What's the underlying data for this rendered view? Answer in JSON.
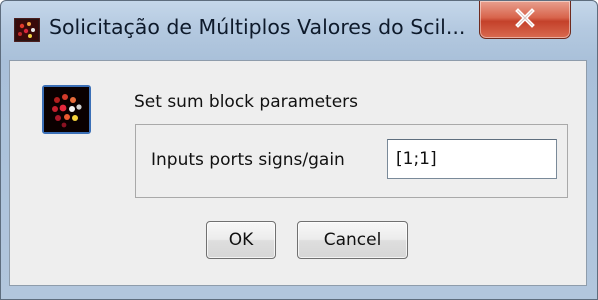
{
  "window": {
    "title": "Solicitação de Múltiplos Valores do Scil...",
    "app_icon": "scilab-icon",
    "close_icon": "close-icon",
    "close_button_color": "#c9432c",
    "frame_color": "#b4c9e0"
  },
  "dialog": {
    "icon": "scilab-dots-icon",
    "message": "Set sum block parameters",
    "parameters": [
      {
        "label": "Inputs ports signs/gain",
        "value": "[1;1]"
      }
    ],
    "buttons": {
      "ok": "OK",
      "cancel": "Cancel"
    }
  }
}
